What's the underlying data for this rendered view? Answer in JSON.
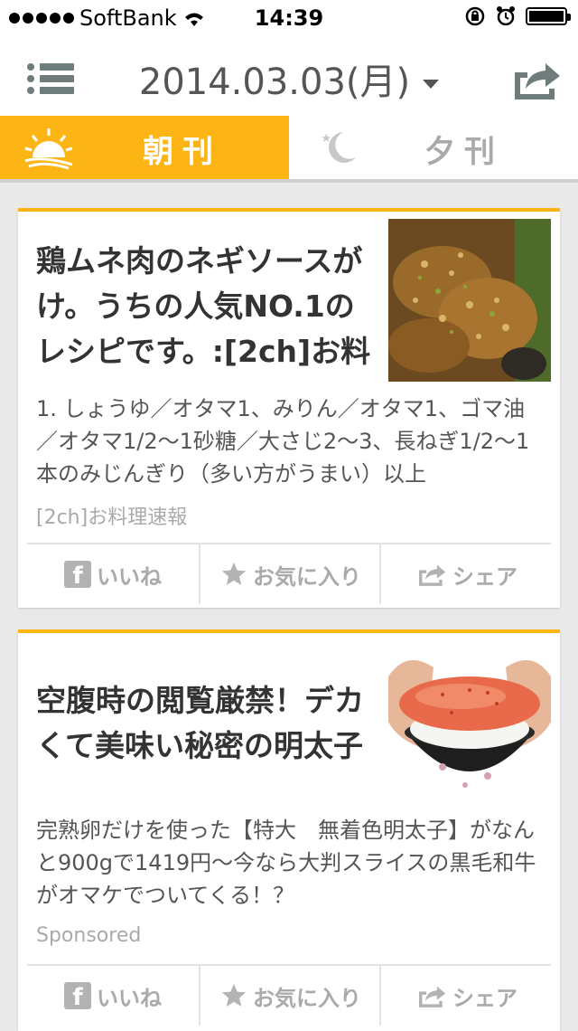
{
  "status_bar": {
    "carrier": "SoftBank",
    "time": "14:39"
  },
  "header": {
    "date": "2014.03.03(月)"
  },
  "tabs": [
    {
      "label": "朝刊",
      "active": true
    },
    {
      "label": "夕刊",
      "active": false
    }
  ],
  "articles": [
    {
      "title": "鶏ムネ肉のネギソースがけ。うちの人気NO.1のレシピです。:[2ch]お料",
      "body": "1. しょうゆ／オタマ1、みりん／オタマ1、ゴマ油／オタマ1/2〜1砂糖／大さじ2〜3、長ねぎ1/2〜1本のみじんぎり（多い方がうまい）以上",
      "source": "[2ch]お料理速報",
      "image_icon": "fried-chicken-photo"
    },
    {
      "title": "空腹時の閲覧厳禁！デカくて美味い秘密の明太子",
      "body": "完熟卵だけを使った【特大　無着色明太子】がなんと900gで1419円〜今なら大判スライスの黒毛和牛がオマケでついてくる！？",
      "source": "Sponsored",
      "image_icon": "mentaiko-rice-bowl-photo"
    }
  ],
  "actions": {
    "like": "いいね",
    "favorite": "お気に入り",
    "share": "シェア"
  },
  "colors": {
    "accent": "#fdb515",
    "icon_gray": "#6f7c7c"
  }
}
